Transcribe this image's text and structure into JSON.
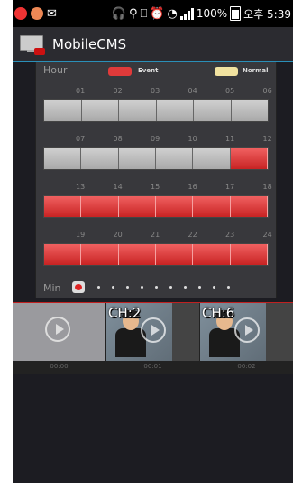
{
  "status_bar": {
    "battery": "100%",
    "time": "오후 5:39"
  },
  "app": {
    "title": "MobileCMS"
  },
  "legend": {
    "hour_label": "Hour",
    "event_label": "Event",
    "normal_label": "Normal",
    "event_color": "#e03a3a",
    "normal_color": "#f1e2a0"
  },
  "hour_rows": [
    {
      "hours": [
        "01",
        "02",
        "03",
        "04",
        "05",
        "06"
      ],
      "states": [
        "normal",
        "normal",
        "normal",
        "normal",
        "normal",
        "normal"
      ]
    },
    {
      "hours": [
        "07",
        "08",
        "09",
        "10",
        "11",
        "12"
      ],
      "states": [
        "normal",
        "normal",
        "normal",
        "normal",
        "normal",
        "event"
      ]
    },
    {
      "hours": [
        "13",
        "14",
        "15",
        "16",
        "17",
        "18"
      ],
      "states": [
        "event",
        "event",
        "event",
        "event",
        "event",
        "event"
      ]
    },
    {
      "hours": [
        "19",
        "20",
        "21",
        "22",
        "23",
        "24"
      ],
      "states": [
        "event",
        "event",
        "event",
        "event",
        "event",
        "event"
      ]
    }
  ],
  "minute": {
    "label": "Min",
    "active_index": 0,
    "dot_count": 10
  },
  "thumbnails": [
    {
      "channel": "",
      "time": "00:00",
      "has_video": false
    },
    {
      "channel": "CH:2",
      "time": "00:01",
      "has_video": true
    },
    {
      "channel": "CH:6",
      "time": "00:02",
      "has_video": true
    }
  ]
}
